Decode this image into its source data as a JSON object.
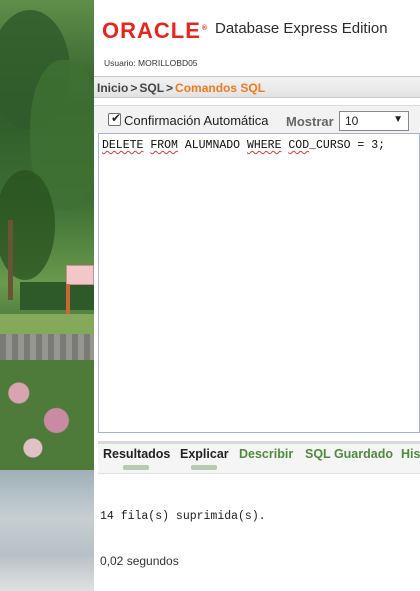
{
  "header": {
    "logo": "ORACLE",
    "logo_mark": "®",
    "product": "Database Express Edition",
    "user": "Usuario: MORILLOBD05"
  },
  "breadcrumb": {
    "items": [
      "Inicio",
      "SQL",
      "Comandos SQL"
    ],
    "separator": ">"
  },
  "toolbar": {
    "autocommit_label": "Confirmación Automática",
    "autocommit_checked": true,
    "mostrar_label": "Mostrar",
    "mostrar_value": "10"
  },
  "editor": {
    "sql": {
      "delete": "DELETE",
      "space1": " ",
      "from": "FROM",
      "space2": " ",
      "table": "ALUMNADO",
      "space3": " ",
      "where": "WHERE",
      "space4": " ",
      "col_a": "COD",
      "col_b": "_CURSO",
      "rest": " = 3;"
    }
  },
  "tabs": [
    "Resultados",
    "Explicar",
    "Describir",
    "SQL Guardado",
    "His"
  ],
  "results": {
    "message": "14 fila(s) suprimida(s).",
    "time": "0,02 segundos"
  },
  "colors": {
    "oracle_red": "#e8261c",
    "breadcrumb_current": "#f07b1e",
    "tab_link": "#4e8b3e"
  }
}
